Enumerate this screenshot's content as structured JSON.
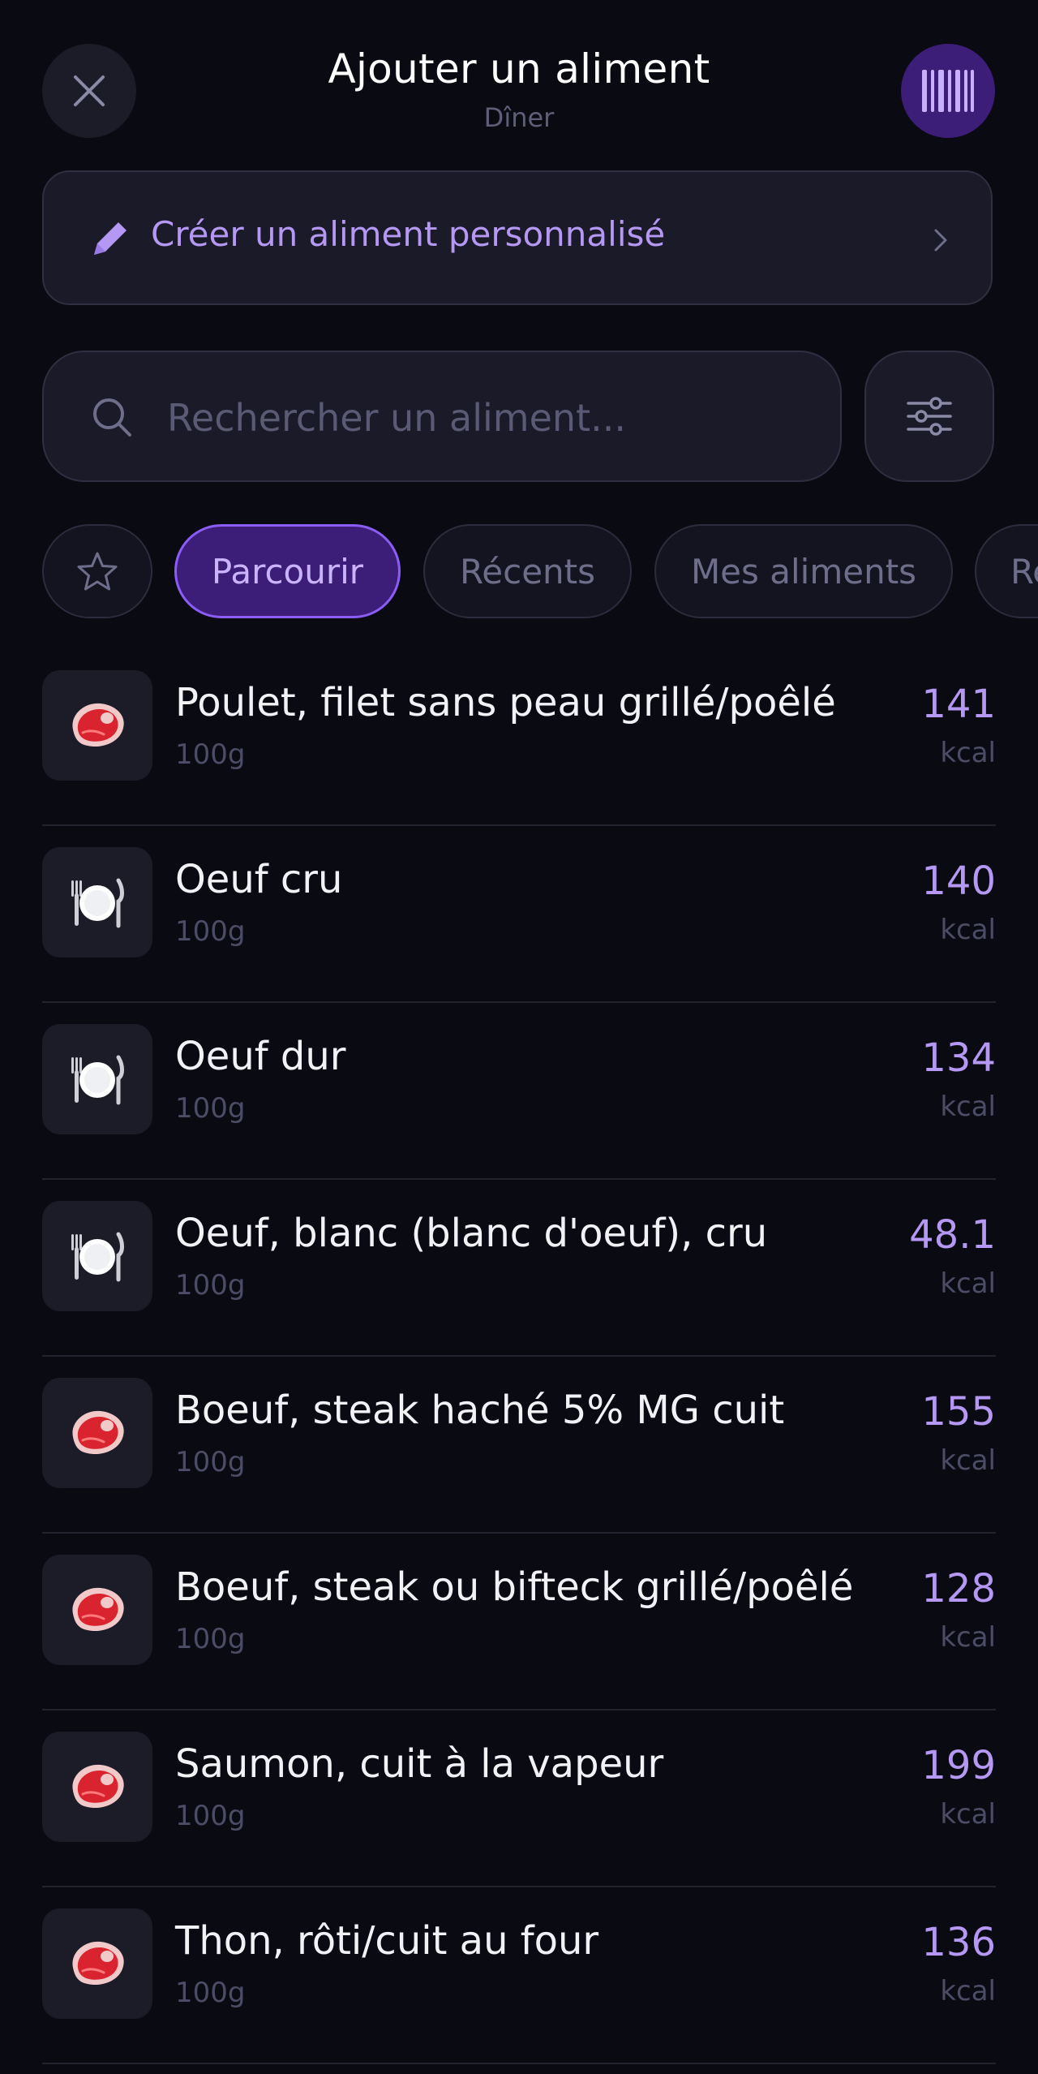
{
  "header": {
    "title": "Ajouter un aliment",
    "subtitle": "Dîner",
    "close_icon": "close-icon",
    "barcode_icon": "barcode-icon"
  },
  "create_custom": {
    "label": "Créer un aliment personnalisé",
    "icon": "pencil-icon"
  },
  "search": {
    "placeholder": "Rechercher un aliment...",
    "value": ""
  },
  "tabs": [
    {
      "label": "",
      "icon": "star-icon",
      "active": false
    },
    {
      "label": "Parcourir",
      "active": true
    },
    {
      "label": "Récents",
      "active": false
    },
    {
      "label": "Mes aliments",
      "active": false
    },
    {
      "label": "Re",
      "active": false
    }
  ],
  "foods": [
    {
      "name": "Poulet, filet sans peau grillé/poêlé",
      "portion": "100g",
      "kcal": "141",
      "unit": "kcal",
      "icon": "meat-icon"
    },
    {
      "name": "Oeuf cru",
      "portion": "100g",
      "kcal": "140",
      "unit": "kcal",
      "icon": "plate-icon"
    },
    {
      "name": "Oeuf dur",
      "portion": "100g",
      "kcal": "134",
      "unit": "kcal",
      "icon": "plate-icon"
    },
    {
      "name": "Oeuf, blanc (blanc d'oeuf), cru",
      "portion": "100g",
      "kcal": "48.1",
      "unit": "kcal",
      "icon": "plate-icon"
    },
    {
      "name": "Boeuf, steak haché 5% MG cuit",
      "portion": "100g",
      "kcal": "155",
      "unit": "kcal",
      "icon": "meat-icon"
    },
    {
      "name": "Boeuf, steak ou bifteck grillé/poêlé",
      "portion": "100g",
      "kcal": "128",
      "unit": "kcal",
      "icon": "meat-icon"
    },
    {
      "name": "Saumon, cuit à la vapeur",
      "portion": "100g",
      "kcal": "199",
      "unit": "kcal",
      "icon": "meat-icon"
    },
    {
      "name": "Thon, rôti/cuit au four",
      "portion": "100g",
      "kcal": "136",
      "unit": "kcal",
      "icon": "meat-icon"
    }
  ],
  "colors": {
    "background": "#0a0a12",
    "accent": "#b598f3",
    "accent_bg": "#3c1e78"
  }
}
